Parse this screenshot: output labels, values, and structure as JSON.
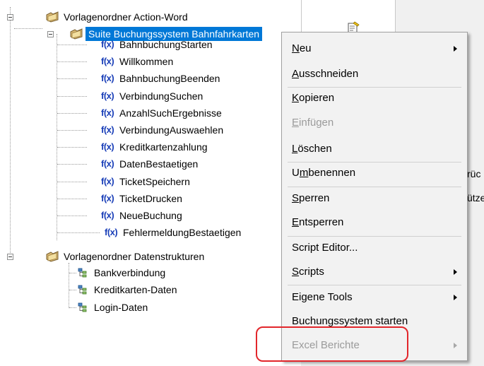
{
  "tree": {
    "folder_action_word": "Vorlagenordner Action-Word",
    "suite": "Suite Buchungssystem Bahnfahrkarten",
    "functions": [
      "BahnbuchungStarten",
      "Willkommen",
      "BahnbuchungBeenden",
      "VerbindungSuchen",
      "AnzahlSuchErgebnisse",
      "VerbindungAuswaehlen",
      "Kreditkartenzahlung",
      "DatenBestaetigen",
      "TicketSpeichern",
      "TicketDrucken",
      "NeueBuchung",
      "FehlermeldungBestaetigen"
    ],
    "function_icon_text": "f(x)",
    "folder_data_structures": "Vorlagenordner Datenstrukturen",
    "structures": [
      "Bankverbindung",
      "Kreditkarten-Daten",
      "Login-Daten"
    ]
  },
  "context_menu": {
    "items": [
      {
        "pre": "",
        "key": "N",
        "post": "eu",
        "submenu": true,
        "disabled": false
      },
      {
        "pre": "",
        "key": "A",
        "post": "usschneiden",
        "submenu": false,
        "disabled": false
      },
      {
        "pre": "",
        "key": "K",
        "post": "opieren",
        "submenu": false,
        "disabled": false
      },
      {
        "pre": "",
        "key": "E",
        "post": "infügen",
        "submenu": false,
        "disabled": true
      },
      {
        "pre": "",
        "key": "L",
        "post": "öschen",
        "submenu": false,
        "disabled": false
      },
      {
        "pre": "U",
        "key": "m",
        "post": "benennen",
        "submenu": false,
        "disabled": false
      },
      {
        "pre": "",
        "key": "S",
        "post": "perren",
        "submenu": false,
        "disabled": false
      },
      {
        "pre": "",
        "key": "E",
        "post": "ntsperren",
        "submenu": false,
        "disabled": false
      },
      {
        "pre": "Script Editor...",
        "key": "",
        "post": "",
        "submenu": false,
        "disabled": false
      },
      {
        "pre": "",
        "key": "S",
        "post": "cripts",
        "submenu": true,
        "disabled": false
      },
      {
        "pre": "Eigene Tools",
        "key": "",
        "post": "",
        "submenu": true,
        "disabled": false
      },
      {
        "pre": "Buchungssystem starten",
        "key": "",
        "post": "",
        "submenu": false,
        "disabled": false
      },
      {
        "pre": "Excel Berichte",
        "key": "",
        "post": "",
        "submenu": true,
        "disabled": true
      }
    ]
  },
  "side_panel": {
    "partial_text_1": "rüc",
    "partial_text_2": "ütze"
  },
  "colors": {
    "selection": "#0078d7",
    "highlight_box": "#e2262b",
    "function_icon": "#1a3fb8"
  }
}
